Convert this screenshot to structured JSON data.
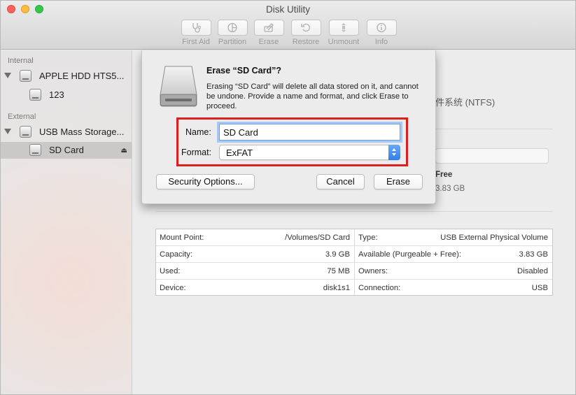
{
  "window": {
    "title": "Disk Utility"
  },
  "toolbar": {
    "items": [
      {
        "label": "First Aid",
        "icon": "stethoscope-icon"
      },
      {
        "label": "Partition",
        "icon": "partition-pie-icon"
      },
      {
        "label": "Erase",
        "icon": "erase-icon"
      },
      {
        "label": "Restore",
        "icon": "restore-icon"
      },
      {
        "label": "Unmount",
        "icon": "unmount-icon"
      },
      {
        "label": "Info",
        "icon": "info-icon"
      }
    ]
  },
  "sidebar": {
    "internal_header": "Internal",
    "external_header": "External",
    "items": [
      {
        "label": "APPLE HDD HTS5..."
      },
      {
        "label": "123"
      },
      {
        "label": "USB Mass Storage..."
      },
      {
        "label": "SD Card",
        "eject": "⏏"
      }
    ]
  },
  "background": {
    "fs_fragment": "件系统 (NTFS)",
    "free_label": "Free",
    "free_value": "3.83 GB"
  },
  "info": {
    "left": [
      {
        "key": "Mount Point:",
        "value": "/Volumes/SD Card"
      },
      {
        "key": "Capacity:",
        "value": "3.9 GB"
      },
      {
        "key": "Used:",
        "value": "75 MB"
      },
      {
        "key": "Device:",
        "value": "disk1s1"
      }
    ],
    "right": [
      {
        "key": "Type:",
        "value": "USB External Physical Volume"
      },
      {
        "key": "Available (Purgeable + Free):",
        "value": "3.83 GB"
      },
      {
        "key": "Owners:",
        "value": "Disabled"
      },
      {
        "key": "Connection:",
        "value": "USB"
      }
    ]
  },
  "sheet": {
    "title": "Erase “SD Card”?",
    "description": "Erasing “SD Card” will delete all data stored on it, and cannot be undone. Provide a name and format, and click Erase to proceed.",
    "name_label": "Name:",
    "name_value": "SD Card",
    "format_label": "Format:",
    "format_value": "ExFAT",
    "security_button": "Security Options...",
    "cancel_button": "Cancel",
    "erase_button": "Erase",
    "highlight_color": "#d9201c"
  }
}
